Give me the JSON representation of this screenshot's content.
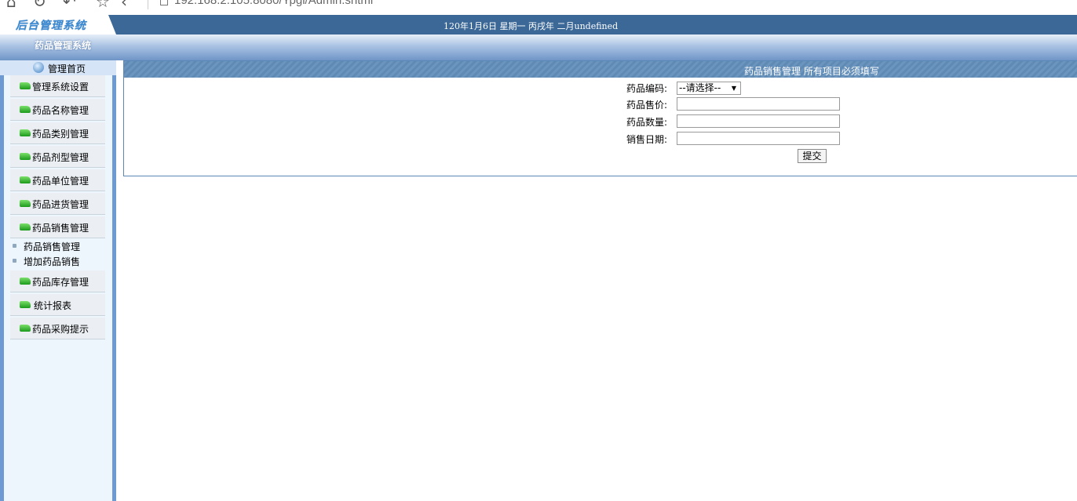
{
  "browser": {
    "url": "192.168.2.105:8080/Ypgl/Admin.shtml"
  },
  "header": {
    "logo": "后台管理系统",
    "date_text": "120年1月6日 星期一 丙戌年 二月undefined"
  },
  "subheader": {
    "title": "药品管理系统"
  },
  "sidebar": {
    "home_label": "管理首页",
    "items": [
      {
        "label": "管理系统设置"
      },
      {
        "label": "药品名称管理"
      },
      {
        "label": "药品类别管理"
      },
      {
        "label": "药品剂型管理"
      },
      {
        "label": "药品单位管理"
      },
      {
        "label": "药品进货管理"
      },
      {
        "label": "药品销售管理"
      },
      {
        "label": "药品库存管理"
      },
      {
        "label": "统计报表"
      },
      {
        "label": "药品采购提示"
      }
    ],
    "subitems": [
      {
        "label": "药品销售管理"
      },
      {
        "label": "增加药品销售"
      }
    ]
  },
  "panel": {
    "title": "药品销售管理  所有项目必须填写",
    "form": {
      "code_label": "药品编码:",
      "code_select_value": "--请选择--",
      "price_label": "药品售价:",
      "price_value": "",
      "quantity_label": "药品数量:",
      "quantity_value": "",
      "date_label": "销售日期:",
      "date_value": "",
      "submit_label": "提交"
    }
  }
}
